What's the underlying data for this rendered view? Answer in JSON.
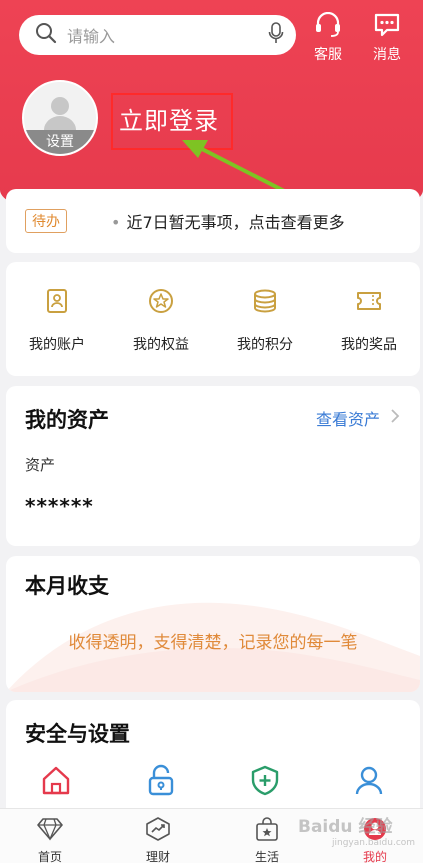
{
  "header": {
    "search_placeholder": "请输入",
    "service_label": "客服",
    "message_label": "消息"
  },
  "profile": {
    "settings_label": "设置",
    "login_label": "立即登录"
  },
  "todo": {
    "badge": "待办",
    "text": "近7日暂无事项，点击查看更多"
  },
  "shortcuts": [
    {
      "label": "我的账户",
      "icon": "account-card-icon"
    },
    {
      "label": "我的权益",
      "icon": "star-badge-icon"
    },
    {
      "label": "我的积分",
      "icon": "coins-icon"
    },
    {
      "label": "我的奖品",
      "icon": "ticket-icon"
    }
  ],
  "assets": {
    "title": "我的资产",
    "view_link": "查看资产",
    "label": "资产",
    "value": "******"
  },
  "income": {
    "title": "本月收支",
    "desc": "收得透明，支得清楚，记录您的每一笔"
  },
  "security": {
    "title": "安全与设置"
  },
  "tabbar": [
    {
      "label": "首页",
      "icon": "diamond-icon"
    },
    {
      "label": "理财",
      "icon": "chart-trend-icon"
    },
    {
      "label": "生活",
      "icon": "bag-star-icon"
    },
    {
      "label": "我的",
      "icon": "profile-badge-icon"
    }
  ],
  "watermark": {
    "brand": "Baidu 经验",
    "sub": "jingyan.baidu.com"
  },
  "colors": {
    "brand_red": "#e5394c",
    "accent_gold": "#c9a040",
    "link_blue": "#3a7bd5"
  }
}
